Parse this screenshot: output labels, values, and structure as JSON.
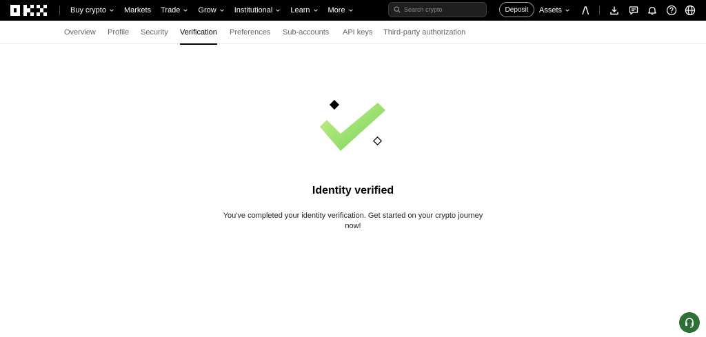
{
  "nav": {
    "items": [
      {
        "label": "Buy crypto",
        "has_menu": true
      },
      {
        "label": "Markets",
        "has_menu": false
      },
      {
        "label": "Trade",
        "has_menu": true
      },
      {
        "label": "Grow",
        "has_menu": true
      },
      {
        "label": "Institutional",
        "has_menu": true
      },
      {
        "label": "Learn",
        "has_menu": true
      },
      {
        "label": "More",
        "has_menu": true
      }
    ],
    "search_placeholder": "Search crypto",
    "deposit_label": "Deposit",
    "assets_label": "Assets"
  },
  "tabs": [
    {
      "label": "Overview",
      "active": false
    },
    {
      "label": "Profile",
      "active": false
    },
    {
      "label": "Security",
      "active": false
    },
    {
      "label": "Verification",
      "active": true
    },
    {
      "label": "Preferences",
      "active": false
    },
    {
      "label": "Sub-accounts",
      "active": false
    },
    {
      "label": "API keys",
      "active": false
    },
    {
      "label": "Third-party authorization",
      "active": false
    }
  ],
  "main": {
    "title": "Identity verified",
    "description": "You've completed your identity verification. Get started on your crypto journey now!"
  },
  "icons": {
    "logo": "okx-logo",
    "search": "search-icon",
    "profile": "user-icon",
    "download": "download-icon",
    "messages": "chat-icon",
    "notifications": "bell-icon",
    "help": "help-icon",
    "language": "globe-icon",
    "support": "headset-icon"
  },
  "colors": {
    "topbar_bg": "#000000",
    "check_light": "#c9f08a",
    "check_dark": "#74d25c",
    "support_bg": "#2e6f35"
  }
}
